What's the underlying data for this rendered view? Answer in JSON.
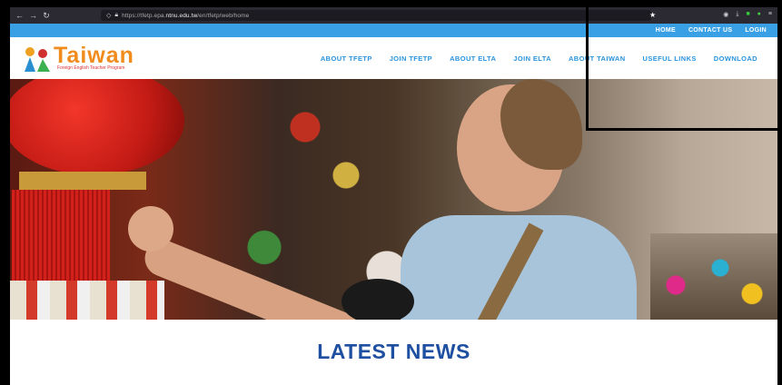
{
  "browser": {
    "url_prefix": "https://tfetp.epa.",
    "url_host": "ntnu.edu.tw",
    "url_path": "/en/tfetp/web/home"
  },
  "topbar": {
    "items": [
      "HOME",
      "CONTACT US",
      "LOGIN"
    ]
  },
  "logo": {
    "word": "Taiwan",
    "subtitle": "Foreign English Teacher Program"
  },
  "mainnav": {
    "items": [
      "ABOUT TFETP",
      "JOIN TFETP",
      "ABOUT ELTA",
      "JOIN ELTA",
      "ABOUT TAIWAN",
      "USEFUL LINKS",
      "DOWNLOAD"
    ]
  },
  "news": {
    "title": "LATEST NEWS"
  },
  "colors": {
    "topbar": "#3aa0e6",
    "nav": "#2a93dd",
    "news_title": "#1f4fa0"
  }
}
